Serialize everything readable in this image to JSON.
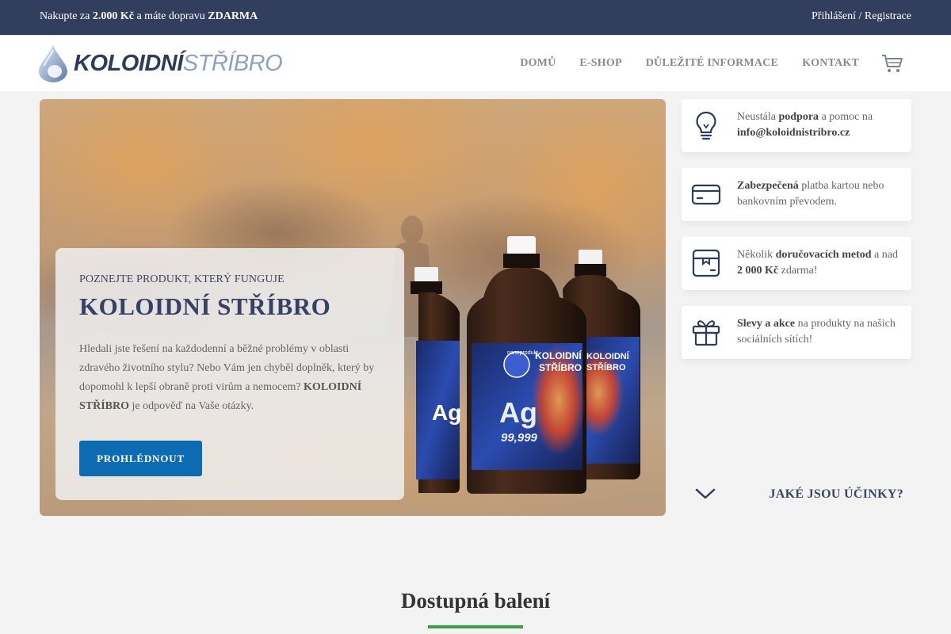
{
  "topbar": {
    "promo": {
      "pre": "Nakupte za ",
      "amount": "2.000 Kč",
      "mid": " a máte dopravu ",
      "free": "ZDARMA"
    },
    "login": "Přihlášení",
    "separator": " / ",
    "register": "Registrace"
  },
  "logo": {
    "bold": "KOLOIDNÍ",
    "light": "STŘÍBRO"
  },
  "nav": {
    "items": [
      {
        "label": "DOMŮ"
      },
      {
        "label": "E-SHOP"
      },
      {
        "label": "DŮLEŽITÉ INFORMACE"
      },
      {
        "label": "KONTAKT"
      }
    ]
  },
  "hero": {
    "subtitle": "POZNEJTE PRODUKT, KTERÝ FUNGUJE",
    "title": "KOLOIDNÍ STŘÍBRO",
    "text_1": "Hledali jste řešení na každodenní a běžné problémy v oblasti zdravého životního stylu? Nebo Vám jen chyběl doplněk, který by dopomohl k lepší obraně proti virům a nemocem? ",
    "text_bold": "KOLOIDNÍ STŘÍBRO",
    "text_2": " je odpověď na Vaše otázky.",
    "button": "PROHLÉDNOUT",
    "bottle": {
      "brand": "KOLOIDNÍ",
      "brand2": "STŘÍBRO",
      "maker": "nanoprodukt",
      "symbol": "Ag",
      "purity": "99,999"
    }
  },
  "features": [
    {
      "icon": "lightbulb-icon",
      "pre": "Neustála ",
      "bold": "podpora",
      "post": " a pomoc na ",
      "bold2": "info@koloidnistribro.cz",
      "post2": ""
    },
    {
      "icon": "credit-card-icon",
      "pre": "",
      "bold": "Zabezpečená",
      "post": " platba kartou nebo bankovním převodem.",
      "bold2": "",
      "post2": ""
    },
    {
      "icon": "package-icon",
      "pre": "Několik ",
      "bold": "doručovacích metod",
      "post": " a nad ",
      "bold2": "2 000 Kč",
      "post2": " zdarma!"
    },
    {
      "icon": "gift-icon",
      "pre": "",
      "bold": "Slevy a akce",
      "post": " na produkty na našich sociálních sítích!",
      "bold2": "",
      "post2": ""
    }
  ],
  "effects_link": "JAKÉ JSOU ÚČINKY?",
  "section": {
    "title": "Dostupná balení"
  },
  "colors": {
    "topbar": "#323e5e",
    "accent": "#0d6bb2",
    "heading": "#354166",
    "underline": "#3aa041"
  }
}
